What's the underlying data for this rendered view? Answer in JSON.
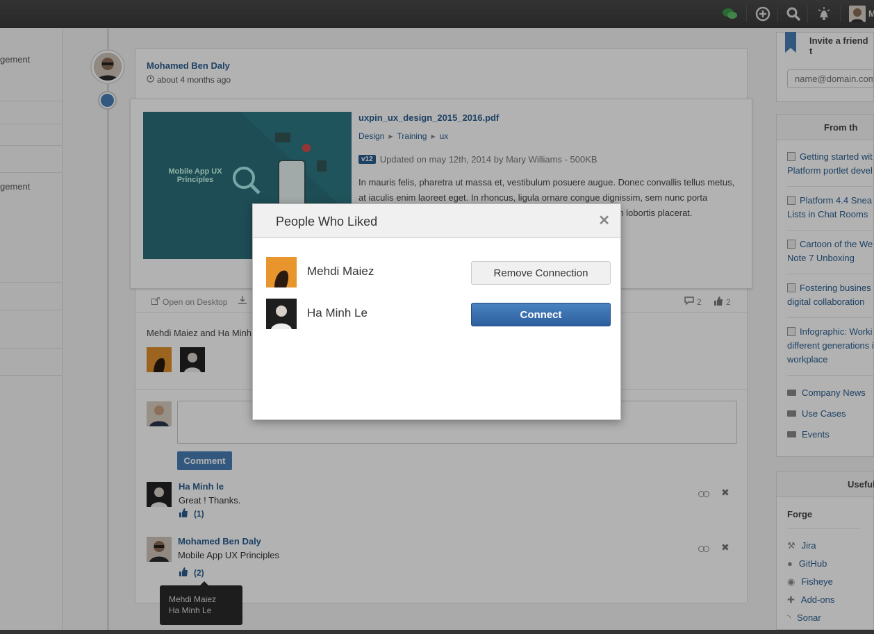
{
  "topbar": {
    "user_initial": "M",
    "icons": [
      "chat-icon",
      "add-icon",
      "search-icon",
      "notifications-icon"
    ]
  },
  "leftnav": {
    "items": [
      "gement",
      "gement"
    ]
  },
  "activity": {
    "author": "Mohamed Ben Daly",
    "posted": "about 4 months ago",
    "doc": {
      "title": "uxpin_ux_design_2015_2016.pdf",
      "breadcrumb": [
        "Design",
        "Training",
        "ux"
      ],
      "version": "v12",
      "updated": "Updated on may 12th, 2014 by Mary Williams - 500KB",
      "description": "In mauris felis, pharetra ut massa et, vestibulum posuere augue. Donec convallis tellus metus, at iaculis enim laoreet eget. In rhoncus, ligula ornare congue dignissim, sem nunc porta neque, nec rutrum elit sapien non lorem. Vestibulum condimentum lobortis placerat.",
      "thumb_title": "Mobile App UX Principles"
    },
    "actions": {
      "open_desktop": "Open on Desktop",
      "comments_count": "2",
      "likes_count": "2"
    },
    "likes_text": "Mehdi Maiez and Ha Minh Le like this.",
    "comment_button": "Comment",
    "comments": [
      {
        "name": "Ha Minh le",
        "text": "Great ! Thanks.",
        "likes": "(1)"
      },
      {
        "name": "Mohamed Ben Daly",
        "text": "Mobile App UX Principles",
        "likes": "(2)"
      }
    ],
    "tooltip": [
      "Mehdi Maiez",
      "Ha Minh Le"
    ]
  },
  "sidebar": {
    "invite": {
      "title": "Invite a friend t",
      "placeholder": "name@domain.com"
    },
    "from": {
      "title": "From th",
      "links": [
        [
          "Getting started wit",
          "Platform portlet devel"
        ],
        [
          "Platform 4.4 Snea",
          "Lists in Chat Rooms"
        ],
        [
          "Cartoon of the We",
          "Note 7 Unboxing"
        ],
        [
          "Fostering busines",
          "digital collaboration"
        ],
        [
          "Infographic: Worki",
          "different generations i",
          "workplace"
        ]
      ],
      "folders": [
        "Company News",
        "Use Cases",
        "Events"
      ]
    },
    "useful": {
      "title": "Useful",
      "section": "Forge",
      "links": [
        "Jira",
        "GitHub",
        "Fisheye",
        "Add-ons",
        "Sonar"
      ]
    }
  },
  "modal": {
    "title": "People Who Liked",
    "people": [
      {
        "name": "Mehdi Maiez",
        "action": "Remove Connection"
      },
      {
        "name": "Ha Minh Le",
        "action": "Connect"
      }
    ]
  }
}
